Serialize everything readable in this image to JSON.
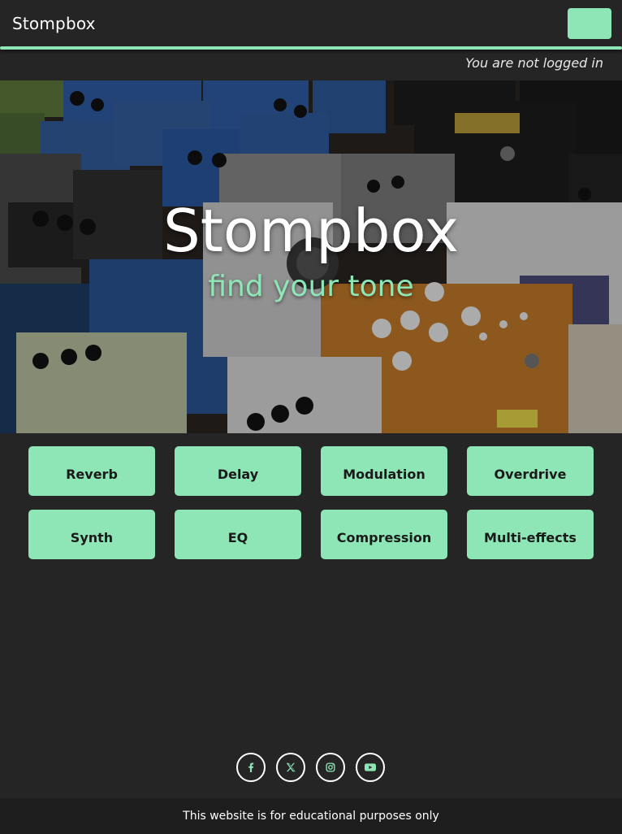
{
  "navbar": {
    "brand": "Stompbox",
    "menu_button_color": "#8ee6b6"
  },
  "login_status": "You are not logged in",
  "hero": {
    "title": "Stompbox",
    "subtitle": "find your tone",
    "image_subject": "guitar-effects-pedalboard-photo"
  },
  "categories": [
    {
      "label": "Reverb"
    },
    {
      "label": "Delay"
    },
    {
      "label": "Modulation"
    },
    {
      "label": "Overdrive"
    },
    {
      "label": "Synth"
    },
    {
      "label": "EQ"
    },
    {
      "label": "Compression"
    },
    {
      "label": "Multi-effects"
    }
  ],
  "social": [
    {
      "icon": "facebook-icon"
    },
    {
      "icon": "x-twitter-icon"
    },
    {
      "icon": "instagram-icon"
    },
    {
      "icon": "youtube-icon"
    }
  ],
  "footer": {
    "text": "This website is for educational purposes only"
  },
  "colors": {
    "accent": "#8ee6b6",
    "background": "#252525",
    "footer": "#1e1e1e"
  }
}
